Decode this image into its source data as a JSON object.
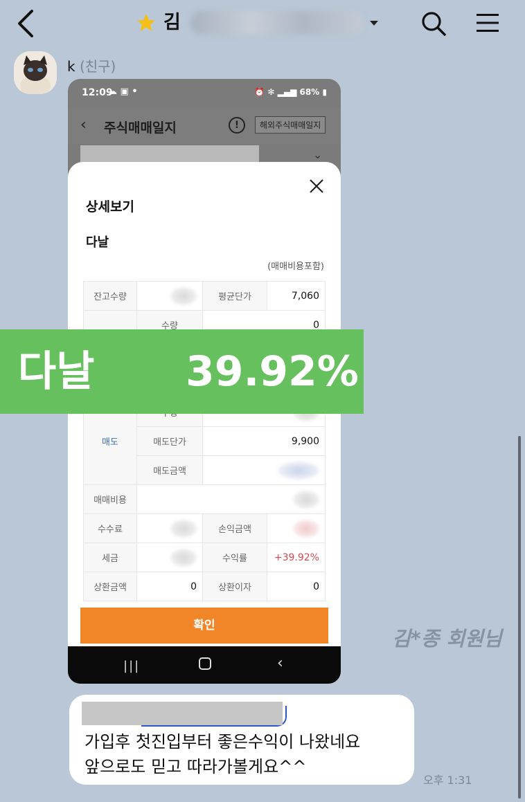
{
  "header": {
    "title_visible": "김",
    "colors": {
      "star": "#f4c017",
      "background": "#b9c7d6"
    }
  },
  "message": {
    "sender_name": "k",
    "sender_tag": "(친구)",
    "time": "오후 1:31",
    "text_line1": "가입후 첫진입부터 좋은수익이 나왔네요",
    "text_line2": "앞으로도 믿고 따라가볼게요^^"
  },
  "phone": {
    "status_time": "12:09",
    "battery": "68%",
    "screen_title": "주식매매일지",
    "overseas_button": "해외주식매매일지",
    "sheet_title": "상세보기",
    "stock_name": "다날",
    "fee_note": "(매매비용포함)",
    "rows": {
      "balance_qty_label": "잔고수량",
      "avg_price_label": "평균단가",
      "avg_price_value": "7,060",
      "qty_label": "수량",
      "qty_value": "0",
      "sell_qty_label": "수량",
      "sell_label": "매도",
      "sell_price_label": "매도단가",
      "sell_price_value": "9,900",
      "sell_amount_label": "매도금액",
      "trade_cost_label": "매매비용",
      "commission_label": "수수료",
      "pnl_label": "손익금액",
      "tax_label": "세금",
      "return_label": "수익률",
      "return_value": "+39.92%",
      "repay_amount_label": "상환금액",
      "repay_amount_value": "0",
      "repay_interest_label": "상환이자",
      "repay_interest_value": "0"
    },
    "confirm_button": "확인"
  },
  "banner": {
    "name": "다날",
    "percent": "39.92%",
    "color": "#66c05d"
  },
  "watermark": "김*종 회원님"
}
